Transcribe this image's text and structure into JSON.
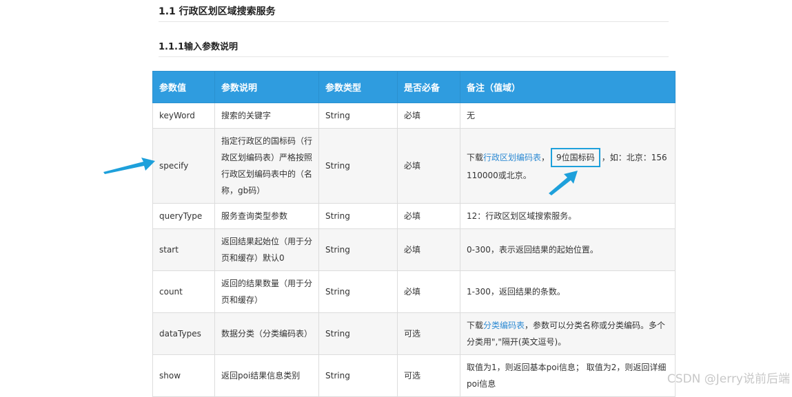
{
  "heading": "1.1 行政区划区域搜索服务",
  "subheading": "1.1.1输入参数说明",
  "table": {
    "headers": [
      "参数值",
      "参数说明",
      "参数类型",
      "是否必备",
      "备注（值域）"
    ],
    "rows": [
      {
        "name": "keyWord",
        "desc": "搜索的关键字",
        "type": "String",
        "required": "必填",
        "note": "无"
      },
      {
        "name": "specify",
        "desc": "指定行政区的国标码（行政区划编码表）严格按照行政区划编码表中的（名称，gb码）",
        "type": "String",
        "required": "必填",
        "note_prefix": "下载",
        "note_link": "行政区划编码表",
        "note_mid": "，",
        "note_boxed": "9位国标码",
        "note_suffix": "，如：北京：156110000或北京。"
      },
      {
        "name": "queryType",
        "desc": "服务查询类型参数",
        "type": "String",
        "required": "必填",
        "note": "12：行政区划区域搜索服务。"
      },
      {
        "name": "start",
        "desc": "返回结果起始位（用于分页和缓存）默认0",
        "type": "String",
        "required": "必填",
        "note": "0-300，表示返回结果的起始位置。"
      },
      {
        "name": "count",
        "desc": "返回的结果数量（用于分页和缓存）",
        "type": "String",
        "required": "必填",
        "note": "1-300，返回结果的条数。"
      },
      {
        "name": "dataTypes",
        "desc": "数据分类（分类编码表）",
        "type": "String",
        "required": "可选",
        "note_prefix": "下载",
        "note_link": "分类编码表",
        "note_suffix": "，参数可以分类名称或分类编码。多个分类用\",\"隔开(英文逗号)。"
      },
      {
        "name": "show",
        "desc": "返回poi结果信息类别",
        "type": "String",
        "required": "可选",
        "note": "取值为1，则返回基本poi信息； 取值为2，则返回详细poi信息"
      }
    ]
  },
  "watermark": "CSDN @Jerry说前后端",
  "colors": {
    "header_bg": "#2f9cdf",
    "link": "#2f8bd3",
    "arrow": "#1ea0db"
  }
}
